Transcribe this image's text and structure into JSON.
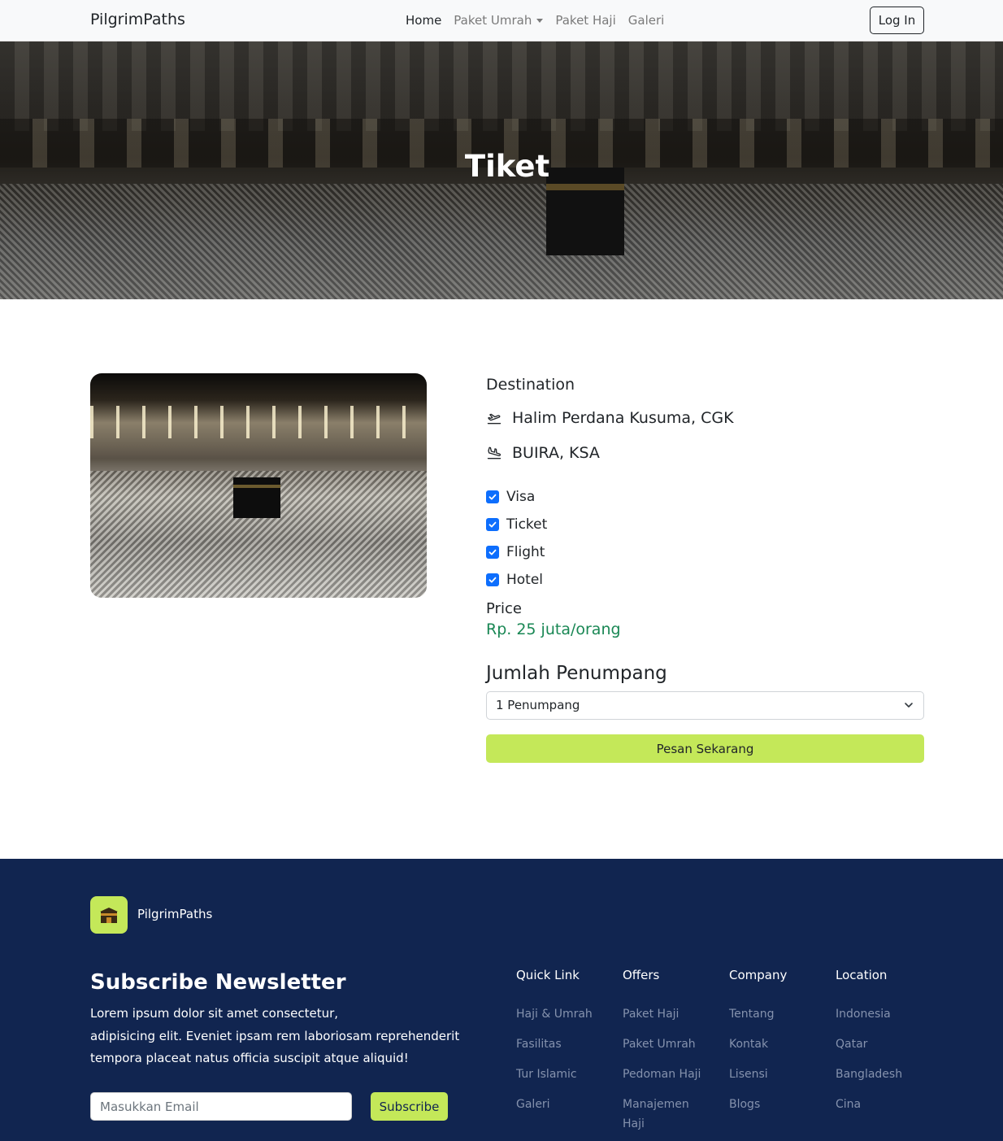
{
  "navbar": {
    "brand": "PilgrimPaths",
    "links": [
      {
        "label": "Home",
        "active": true,
        "dropdown": false
      },
      {
        "label": "Paket Umrah",
        "active": false,
        "dropdown": true
      },
      {
        "label": "Paket Haji",
        "active": false,
        "dropdown": false
      },
      {
        "label": "Galeri",
        "active": false,
        "dropdown": false
      }
    ],
    "login_label": "Log In"
  },
  "hero": {
    "title": "Tiket"
  },
  "ticket": {
    "destination_label": "Destination",
    "departure": {
      "icon": "plane-departure-icon",
      "text": "Halim Perdana Kusuma, CGK"
    },
    "arrival": {
      "icon": "plane-arrival-icon",
      "text": "BUIRA, KSA"
    },
    "features": [
      {
        "label": "Visa",
        "checked": true
      },
      {
        "label": "Ticket",
        "checked": true
      },
      {
        "label": "Flight",
        "checked": true
      },
      {
        "label": "Hotel",
        "checked": true
      }
    ],
    "price_label": "Price",
    "price_value": "Rp. 25 juta/orang",
    "passenger_label": "Jumlah Penumpang",
    "passenger_select_value": "1 Penumpang",
    "order_button": "Pesan Sekarang"
  },
  "footer": {
    "brand": "PilgrimPaths",
    "newsletter_title": "Subscribe Newsletter",
    "newsletter_text_lines": [
      "Lorem ipsum dolor sit amet consectetur,",
      "adipisicing elit. Eveniet ipsam rem laboriosam reprehenderit",
      "tempora placeat natus officia suscipit atque aliquid!"
    ],
    "email_placeholder": "Masukkan Email",
    "subscribe_button": "Subscribe",
    "columns": [
      {
        "title": "Quick Link",
        "items": [
          "Haji & Umrah",
          "Fasilitas",
          "Tur Islamic",
          "Galeri"
        ]
      },
      {
        "title": "Offers",
        "items": [
          "Paket Haji",
          "Paket Umrah",
          "Pedoman Haji",
          "Manajemen Haji"
        ]
      },
      {
        "title": "Company",
        "items": [
          "Tentang",
          "Kontak",
          "Lisensi",
          "Blogs"
        ]
      },
      {
        "title": "Location",
        "items": [
          "Indonesia",
          "Qatar",
          "Bangladesh",
          "Cina"
        ]
      }
    ]
  },
  "colors": {
    "accent_lime": "#c4e859",
    "footer_navy": "#112550",
    "price_green": "#198754",
    "checkbox_blue": "#0d6efd"
  }
}
